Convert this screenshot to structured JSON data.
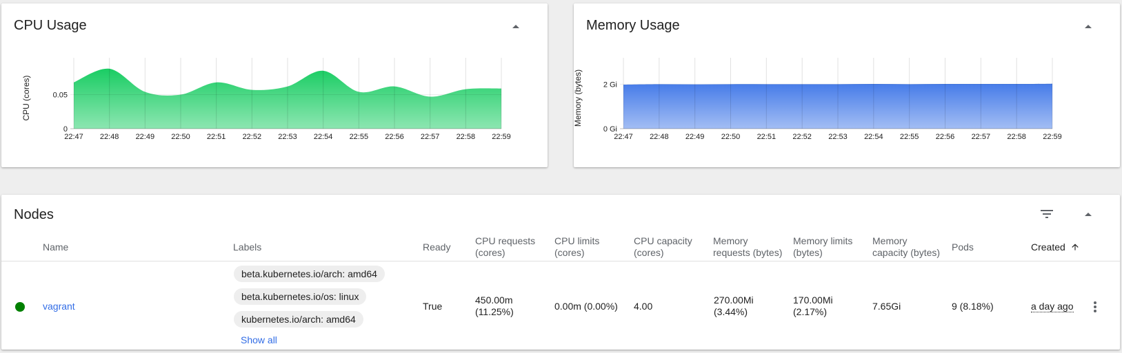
{
  "cpu_card": {
    "title": "CPU Usage",
    "chart_data": {
      "type": "area",
      "x": [
        "22:47",
        "22:48",
        "22:49",
        "22:50",
        "22:51",
        "22:52",
        "22:53",
        "22:54",
        "22:55",
        "22:56",
        "22:57",
        "22:58",
        "22:59"
      ],
      "values": [
        0.068,
        0.088,
        0.054,
        0.05,
        0.068,
        0.057,
        0.062,
        0.085,
        0.054,
        0.062,
        0.047,
        0.058,
        0.059
      ],
      "ylabel": "CPU (cores)",
      "ytick_labels": [
        "0",
        "0.05"
      ],
      "ylim": [
        0,
        0.098
      ],
      "grid": "vertical",
      "color": "#00c752"
    }
  },
  "memory_card": {
    "title": "Memory Usage",
    "chart_data": {
      "type": "area",
      "x": [
        "22:47",
        "22:48",
        "22:49",
        "22:50",
        "22:51",
        "22:52",
        "22:53",
        "22:54",
        "22:55",
        "22:56",
        "22:57",
        "22:58",
        "22:59"
      ],
      "values": [
        1.98,
        2.0,
        1.99,
        2.0,
        2.0,
        2.0,
        2.0,
        2.01,
        2.0,
        2.01,
        2.01,
        2.01,
        2.02
      ],
      "ylabel": "Memory (bytes)",
      "ytick_labels": [
        "0 Gi",
        "2 Gi"
      ],
      "ylim": [
        0,
        3.0
      ],
      "grid": "vertical",
      "color": "#326de6"
    }
  },
  "nodes_card": {
    "title": "Nodes",
    "columns": {
      "name": "Name",
      "labels": "Labels",
      "ready": "Ready",
      "cpu_requests": [
        "CPU requests",
        "(cores)"
      ],
      "cpu_limits": [
        "CPU limits",
        "(cores)"
      ],
      "cpu_capacity": [
        "CPU capacity",
        "(cores)"
      ],
      "mem_requests": [
        "Memory",
        "requests (bytes)"
      ],
      "mem_limits": [
        "Memory limits",
        "(bytes)"
      ],
      "mem_capacity": [
        "Memory",
        "capacity (bytes)"
      ],
      "pods": "Pods",
      "created": "Created"
    },
    "row": {
      "status_color": "#008000",
      "name": "vagrant",
      "labels": [
        "beta.kubernetes.io/arch: amd64",
        "beta.kubernetes.io/os: linux",
        "kubernetes.io/arch: amd64"
      ],
      "show_all": "Show all",
      "ready": "True",
      "cpu_requests": [
        "450.00m",
        "(11.25%)"
      ],
      "cpu_limits": "0.00m (0.00%)",
      "cpu_capacity": "4.00",
      "mem_requests": [
        "270.00Mi",
        "(3.44%)"
      ],
      "mem_limits": [
        "170.00Mi",
        "(2.17%)"
      ],
      "mem_capacity": "7.65Gi",
      "pods": "9 (8.18%)",
      "created": "a day ago"
    },
    "icons": {
      "filter": "filter-icon",
      "collapse": "expand-less-icon",
      "sort": "arrow-upward-icon",
      "menu": "more-vert-icon"
    }
  }
}
